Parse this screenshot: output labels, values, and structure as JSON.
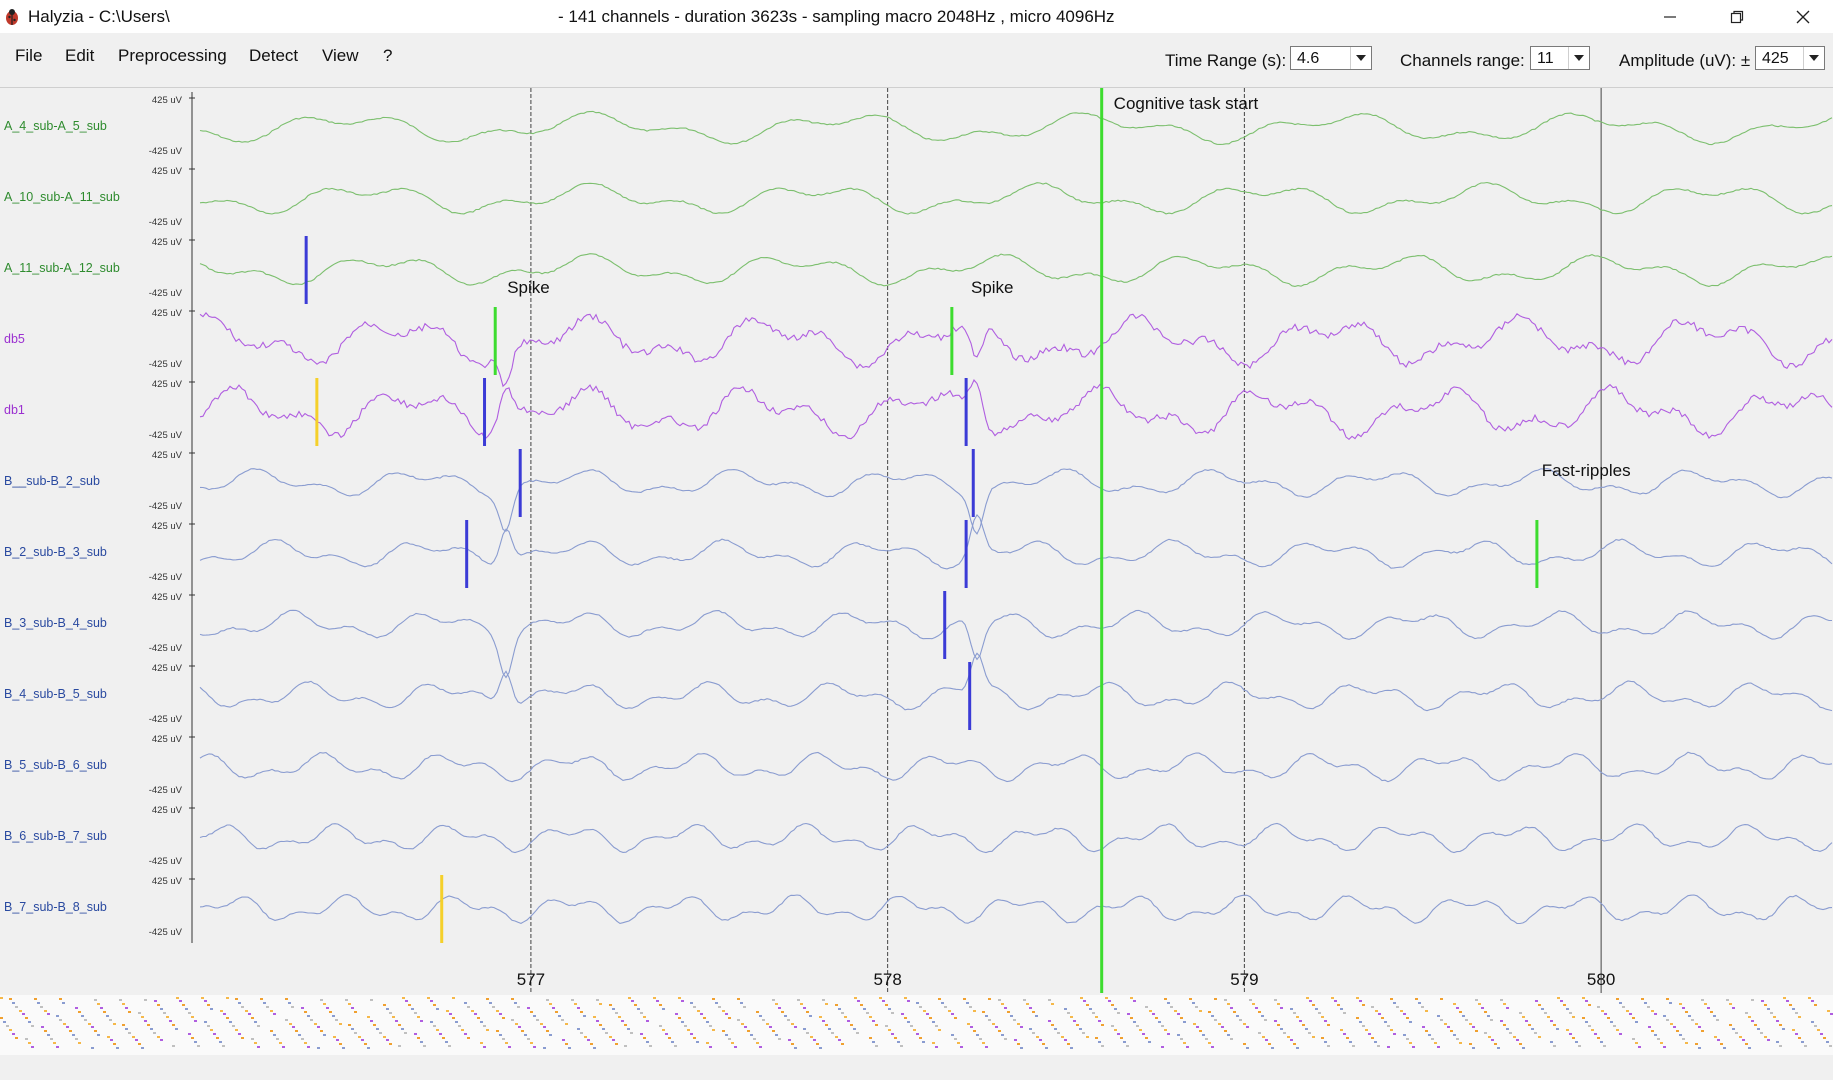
{
  "window": {
    "app_title": "Halyzia - C:\\Users\\",
    "info": "- 141 channels - duration 3623s - sampling macro 2048Hz , micro 4096Hz"
  },
  "menu": [
    "File",
    "Edit",
    "Preprocessing",
    "Detect",
    "View",
    "?"
  ],
  "controls": {
    "time_range_label": "Time Range (s):",
    "time_range_value": "4.6",
    "channels_range_label": "Channels range:",
    "channels_range_value": "11",
    "amplitude_label": "Amplitude (uV): ±",
    "amplitude_value": "425"
  },
  "amplitude_labels": {
    "top": "425 uV",
    "bottom": "-425 uV"
  },
  "channels": [
    {
      "name": "A_4_sub-A_5_sub",
      "group": "A"
    },
    {
      "name": "A_10_sub-A_11_sub",
      "group": "A"
    },
    {
      "name": "A_11_sub-A_12_sub",
      "group": "A"
    },
    {
      "name": "db5",
      "group": "db"
    },
    {
      "name": "db1",
      "group": "db"
    },
    {
      "name": "B__sub-B_2_sub",
      "group": "B"
    },
    {
      "name": "B_2_sub-B_3_sub",
      "group": "B"
    },
    {
      "name": "B_3_sub-B_4_sub",
      "group": "B"
    },
    {
      "name": "B_4_sub-B_5_sub",
      "group": "B"
    },
    {
      "name": "B_5_sub-B_6_sub",
      "group": "B"
    },
    {
      "name": "B_6_sub-B_7_sub",
      "group": "B"
    },
    {
      "name": "B_7_sub-B_8_sub",
      "group": "B"
    }
  ],
  "colors": {
    "A": "#2e8b2e",
    "db": "#9b30d0",
    "B": "#2a4aa0",
    "trace_A": "#7cbf6e",
    "trace_db": "#b05ee0",
    "trace_B": "#8a9cd0",
    "event_green": "#3ddc2f",
    "event_blue": "#3b3bd6",
    "event_yellow": "#f5d02a"
  },
  "x_axis": {
    "ticks": [
      "577",
      "578",
      "579",
      "580"
    ]
  },
  "annotations": [
    {
      "label": "Spike",
      "time": 576.9
    },
    {
      "label": "Spike",
      "time": 578.2
    },
    {
      "label": "Cognitive task start",
      "time": 578.6
    },
    {
      "label": "Fast-ripples",
      "time": 579.8
    }
  ],
  "markers": [
    {
      "channel": 2,
      "time": 576.37,
      "color": "event_blue"
    },
    {
      "channel": 3,
      "time": 576.9,
      "color": "event_green"
    },
    {
      "channel": 3,
      "time": 578.18,
      "color": "event_green"
    },
    {
      "channel": 4,
      "time": 576.4,
      "color": "event_yellow"
    },
    {
      "channel": 4,
      "time": 576.87,
      "color": "event_blue"
    },
    {
      "channel": 4,
      "time": 578.22,
      "color": "event_blue"
    },
    {
      "channel": 5,
      "time": 576.97,
      "color": "event_blue"
    },
    {
      "channel": 5,
      "time": 578.24,
      "color": "event_blue"
    },
    {
      "channel": 6,
      "time": 576.82,
      "color": "event_blue"
    },
    {
      "channel": 6,
      "time": 578.22,
      "color": "event_blue"
    },
    {
      "channel": 6,
      "time": 579.82,
      "color": "event_green"
    },
    {
      "channel": 7,
      "time": 578.16,
      "color": "event_blue"
    },
    {
      "channel": 8,
      "time": 578.23,
      "color": "event_blue"
    },
    {
      "channel": 11,
      "time": 576.75,
      "color": "event_yellow"
    }
  ]
}
